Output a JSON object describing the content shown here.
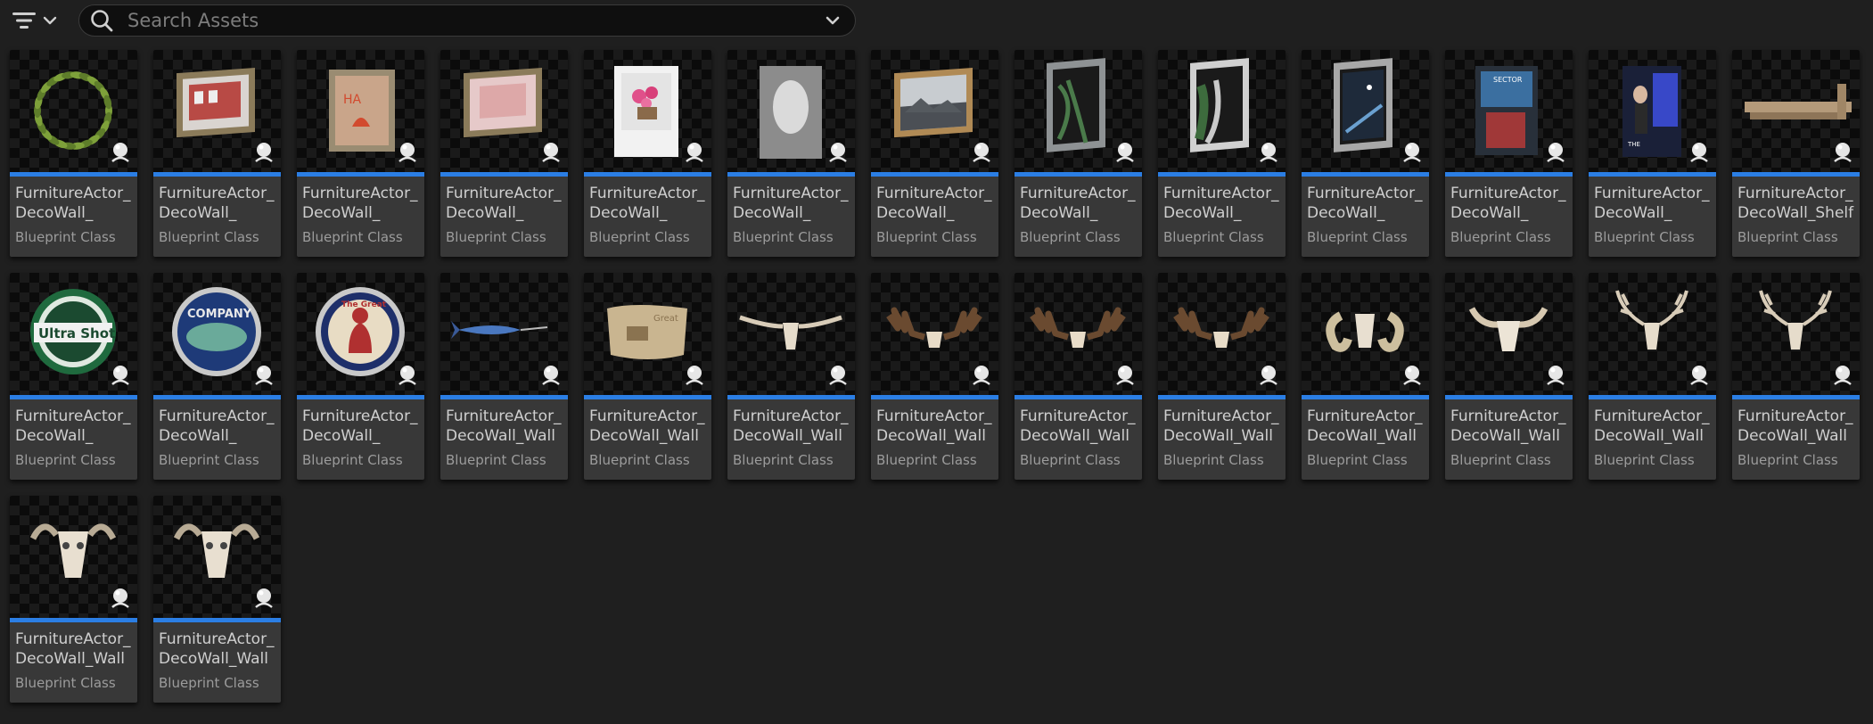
{
  "toolbar": {
    "filter_icon": "filter-lines-icon",
    "dropdown_icon": "chevron-down-icon"
  },
  "search": {
    "placeholder": "Search Assets",
    "value": ""
  },
  "colors": {
    "accent": "#2b7ee4",
    "tile_bg": "#383838",
    "background": "#1f1f1f"
  },
  "assets": [
    {
      "name": "FurnitureActor_\nDecoWall_",
      "type": "Blueprint Class",
      "thumb": "wreath"
    },
    {
      "name": "FurnitureActor_\nDecoWall_",
      "type": "Blueprint Class",
      "thumb": "frame-building"
    },
    {
      "name": "FurnitureActor_\nDecoWall_",
      "type": "Blueprint Class",
      "thumb": "frame-cat"
    },
    {
      "name": "FurnitureActor_\nDecoWall_",
      "type": "Blueprint Class",
      "thumb": "frame-blur"
    },
    {
      "name": "FurnitureActor_\nDecoWall_",
      "type": "Blueprint Class",
      "thumb": "frame-flowers"
    },
    {
      "name": "FurnitureActor_\nDecoWall_",
      "type": "Blueprint Class",
      "thumb": "frame-ghost"
    },
    {
      "name": "FurnitureActor_\nDecoWall_",
      "type": "Blueprint Class",
      "thumb": "frame-landscape"
    },
    {
      "name": "FurnitureActor_\nDecoWall_",
      "type": "Blueprint Class",
      "thumb": "frame-forest"
    },
    {
      "name": "FurnitureActor_\nDecoWall_",
      "type": "Blueprint Class",
      "thumb": "frame-path"
    },
    {
      "name": "FurnitureActor_\nDecoWall_",
      "type": "Blueprint Class",
      "thumb": "frame-night"
    },
    {
      "name": "FurnitureActor_\nDecoWall_",
      "type": "Blueprint Class",
      "thumb": "poster-scifi"
    },
    {
      "name": "FurnitureActor_\nDecoWall_",
      "type": "Blueprint Class",
      "thumb": "poster-figure"
    },
    {
      "name": "FurnitureActor_\nDecoWall_Shelf",
      "type": "Blueprint Class",
      "thumb": "shelf"
    },
    {
      "name": "FurnitureActor_\nDecoWall_",
      "type": "Blueprint Class",
      "thumb": "sign-ultra-shot",
      "label": "Ultra Shot"
    },
    {
      "name": "FurnitureActor_\nDecoWall_",
      "type": "Blueprint Class",
      "thumb": "sign-company",
      "label": "COMPANY"
    },
    {
      "name": "FurnitureActor_\nDecoWall_",
      "type": "Blueprint Class",
      "thumb": "sign-great",
      "label": "The Great"
    },
    {
      "name": "FurnitureActor_\nDecoWall_Wall",
      "type": "Blueprint Class",
      "thumb": "swordfish"
    },
    {
      "name": "FurnitureActor_\nDecoWall_Wall",
      "type": "Blueprint Class",
      "thumb": "wood-plaque"
    },
    {
      "name": "FurnitureActor_\nDecoWall_Wall",
      "type": "Blueprint Class",
      "thumb": "longhorn-skull"
    },
    {
      "name": "FurnitureActor_\nDecoWall_Wall",
      "type": "Blueprint Class",
      "thumb": "moose-antlers"
    },
    {
      "name": "FurnitureActor_\nDecoWall_Wall",
      "type": "Blueprint Class",
      "thumb": "moose-antlers"
    },
    {
      "name": "FurnitureActor_\nDecoWall_Wall",
      "type": "Blueprint Class",
      "thumb": "moose-antlers"
    },
    {
      "name": "FurnitureActor_\nDecoWall_Wall",
      "type": "Blueprint Class",
      "thumb": "ram-skull"
    },
    {
      "name": "FurnitureActor_\nDecoWall_Wall",
      "type": "Blueprint Class",
      "thumb": "bull-skull"
    },
    {
      "name": "FurnitureActor_\nDecoWall_Wall",
      "type": "Blueprint Class",
      "thumb": "deer-skull"
    },
    {
      "name": "FurnitureActor_\nDecoWall_Wall",
      "type": "Blueprint Class",
      "thumb": "deer-skull"
    },
    {
      "name": "FurnitureActor_\nDecoWall_Wall",
      "type": "Blueprint Class",
      "thumb": "goat-skull"
    },
    {
      "name": "FurnitureActor_\nDecoWall_Wall",
      "type": "Blueprint Class",
      "thumb": "goat-skull"
    }
  ]
}
